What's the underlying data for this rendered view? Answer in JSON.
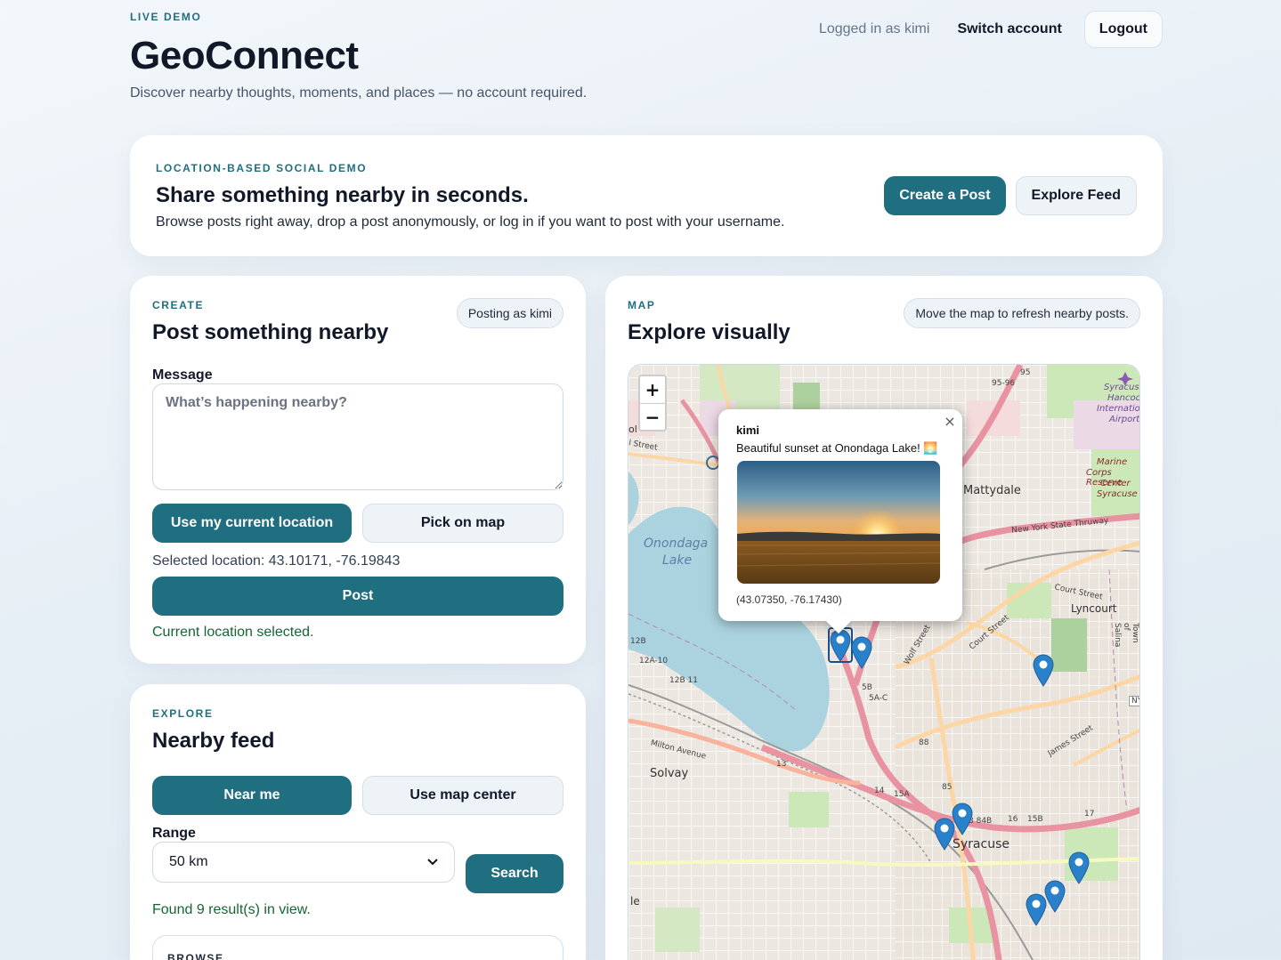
{
  "header": {
    "eyebrow": "LIVE DEMO",
    "brand": "GeoConnect",
    "tagline": "Discover nearby thoughts, moments, and places — no account required.",
    "logged_in": "Logged in as kimi",
    "switch_account": "Switch account",
    "logout": "Logout"
  },
  "hero": {
    "eyebrow": "LOCATION-BASED SOCIAL DEMO",
    "title": "Share something nearby in seconds.",
    "description": "Browse posts right away, drop a post anonymously, or log in if you want to post with your username.",
    "create_post": "Create a Post",
    "explore_feed": "Explore Feed"
  },
  "create": {
    "eyebrow": "CREATE",
    "title": "Post something nearby",
    "posting_as": "Posting as kimi",
    "message_label": "Message",
    "message_placeholder": "What’s happening nearby?",
    "use_location": "Use my current location",
    "pick_on_map": "Pick on map",
    "selected_location": "Selected location: 43.10171, -76.19843",
    "post": "Post",
    "status": "Current location selected."
  },
  "explore": {
    "eyebrow": "EXPLORE",
    "title": "Nearby feed",
    "near_me": "Near me",
    "use_map_center": "Use map center",
    "range_label": "Range",
    "range_value": "50 km",
    "search": "Search",
    "status": "Found 9 result(s) in view.",
    "browse_eyebrow": "BROWSE"
  },
  "map": {
    "eyebrow": "MAP",
    "title": "Explore visually",
    "hint": "Move the map to refresh nearby posts.",
    "zoom_in": "+",
    "zoom_out": "−",
    "popup": {
      "user": "kimi",
      "text": "Beautiful sunset at Onondaga Lake! 🌅",
      "coords": "(43.07350, -76.17430)",
      "close": "×"
    },
    "labels": {
      "mattydale": "Mattydale",
      "onondaga1": "Onondaga",
      "onondaga2": "Lake",
      "lyncourt": "Lyncourt",
      "solvay": "Solvay",
      "syracuse": "Syracuse",
      "thruway": "New York State Thruway",
      "marine1": "Marine",
      "marine2": "Corps Reserve",
      "marine3": "Center",
      "marine4": "Syracuse",
      "airport1": "Syracuse",
      "airport2": "Hancock",
      "airport3": "International",
      "airport4": "Airport",
      "milton": "Milton Avenue",
      "court": "Court Street",
      "james": "James Street",
      "wolf": "Wolf Street",
      "court2": "Court Street",
      "town": "Town of Salina",
      "ol": "ol",
      "street": "l Street",
      "le": "le",
      "r95": "95",
      "r9596": "95-96",
      "r12b": "12B",
      "r12a": "12A-10",
      "r12b11": "12B 11",
      "r13": "13",
      "r14": "14",
      "r15a": "15A",
      "r16": "16",
      "r15b": "15B",
      "r17": "17",
      "r85": "85",
      "r84b": "8 84B",
      "r88": "88",
      "r5a": "5A-C",
      "r5b": "5B",
      "ny": "NY"
    }
  },
  "colors": {
    "accent": "#1f6f80",
    "success": "#166534",
    "water": "#aad3df",
    "motorway": "#e892a2",
    "marker": "#2a81cb"
  }
}
